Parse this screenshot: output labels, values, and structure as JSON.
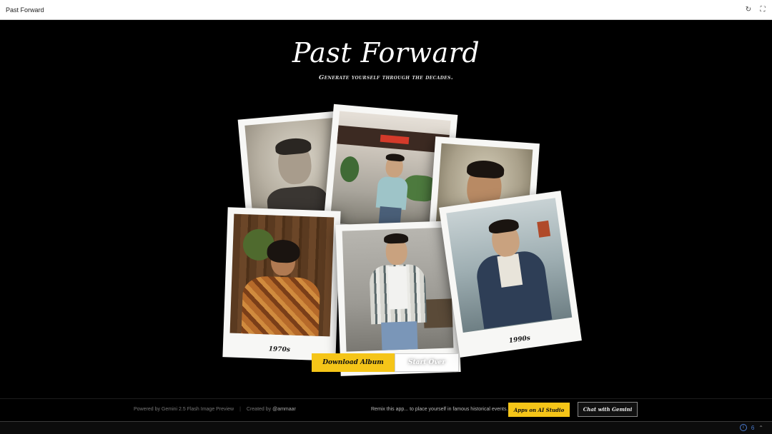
{
  "window": {
    "title": "Past Forward"
  },
  "hero": {
    "title": "Past Forward",
    "subtitle": "Generate yourself through the decades."
  },
  "polaroids": [
    {
      "caption": ""
    },
    {
      "caption": ""
    },
    {
      "caption": ""
    },
    {
      "caption": "1970s"
    },
    {
      "caption": ""
    },
    {
      "caption": "1990s"
    }
  ],
  "actions": {
    "download_label": "Download Album",
    "start_over_label": "Start Over"
  },
  "footer": {
    "powered_by": "Powered by Gemini 2.5 Flash Image Preview",
    "separator": "|",
    "created_by": "Created by",
    "author": "@ammaar",
    "remix_text": "Remix this app...",
    "remix_hint": "to place yourself in famous historical events.",
    "apps_button": "Apps on AI Studio",
    "chat_button": "Chat with Gemini"
  },
  "status": {
    "count": "6"
  },
  "colors": {
    "accent": "#f5c518",
    "background": "#000000"
  },
  "icons": {
    "refresh": "refresh-icon",
    "fullscreen": "fullscreen-icon",
    "info": "info-icon",
    "chevron": "chevron-up-icon"
  }
}
